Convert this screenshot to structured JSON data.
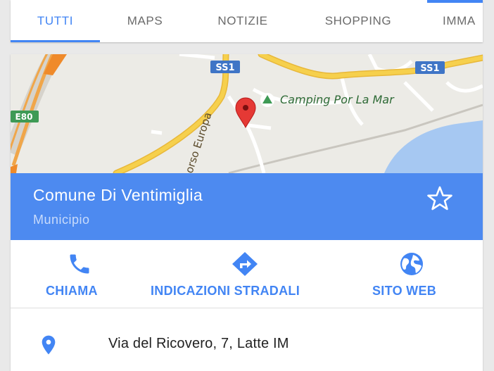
{
  "tabs": [
    {
      "label": "TUTTI",
      "active": true
    },
    {
      "label": "MAPS",
      "active": false
    },
    {
      "label": "NOTIZIE",
      "active": false
    },
    {
      "label": "SHOPPING",
      "active": false
    },
    {
      "label": "IMMA",
      "active": false
    }
  ],
  "map": {
    "labels": {
      "road_ss1_left": "SS1",
      "road_ss1_right": "SS1",
      "road_e80": "E80",
      "street": "orso Europa",
      "poi": "Camping Por La Mar"
    }
  },
  "place": {
    "title": "Comune Di Ventimiglia",
    "category": "Municipio"
  },
  "actions": {
    "call_label": "CHIAMA",
    "directions_label": "INDICAZIONI STRADALI",
    "website_label": "SITO WEB"
  },
  "address": {
    "text": "Via del Ricovero, 7, Latte IM"
  },
  "colors": {
    "accent": "#4285f4",
    "header_bg": "#4d8af0",
    "road": "#f6d04d",
    "water": "#a6c8f2",
    "map_land": "#ecebe6",
    "marker": "#e53935"
  }
}
